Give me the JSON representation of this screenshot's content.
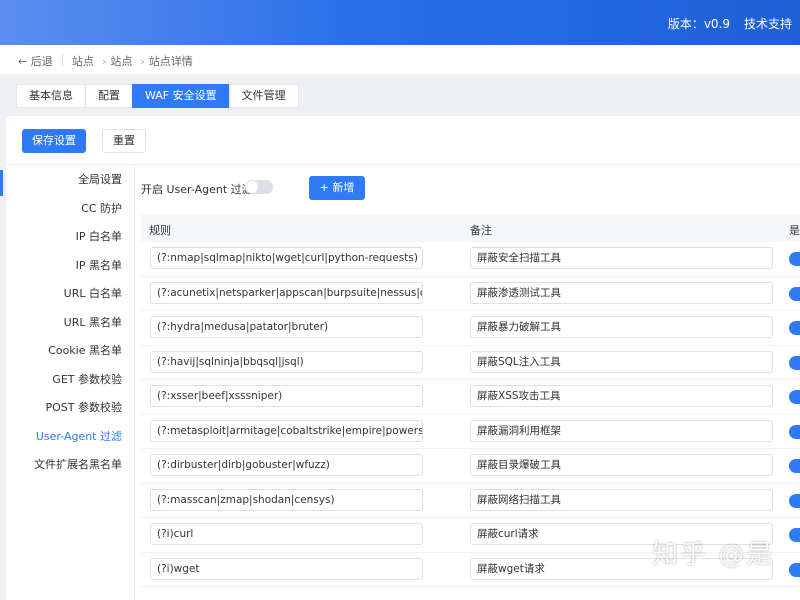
{
  "header": {
    "version": "版本：v0.9",
    "support": "技术支持"
  },
  "breadcrumb": {
    "back": "← 后退",
    "items": [
      "站点",
      "站点",
      "站点详情"
    ]
  },
  "tabs": [
    "基本信息",
    "配置",
    "WAF 安全设置",
    "文件管理"
  ],
  "actions": {
    "save": "保存设置",
    "reset": "重置"
  },
  "sidenav": [
    "全局设置",
    "CC 防护",
    "IP 白名单",
    "IP 黑名单",
    "URL 白名单",
    "URL 黑名单",
    "Cookie 黑名单",
    "GET 参数校验",
    "POST 参数校验",
    "User-Agent 过滤",
    "文件扩展名黑名单"
  ],
  "toolbar": {
    "toggle_label": "开启 User-Agent 过滤",
    "add": "+ 新增"
  },
  "table": {
    "headers": [
      "规则",
      "备注",
      "是"
    ],
    "rows": [
      {
        "rule": "(?:nmap|sqlmap|nikto|wget|curl|python-requests)",
        "note": "屏蔽安全扫描工具"
      },
      {
        "rule": "(?:acunetix|netsparker|appscan|burpsuite|nessus|openvas|zap)",
        "note": "屏蔽渗透测试工具"
      },
      {
        "rule": "(?:hydra|medusa|patator|bruter)",
        "note": "屏蔽暴力破解工具"
      },
      {
        "rule": "(?:havij|sqlninja|bbqsql|jsql)",
        "note": "屏蔽SQL注入工具"
      },
      {
        "rule": "(?:xsser|beef|xsssniper)",
        "note": "屏蔽XSS攻击工具"
      },
      {
        "rule": "(?:metasploit|armitage|cobaltstrike|empire|powersploit)",
        "note": "屏蔽漏洞利用框架"
      },
      {
        "rule": "(?:dirbuster|dirb|gobuster|wfuzz)",
        "note": "屏蔽目录爆破工具"
      },
      {
        "rule": "(?:masscan|zmap|shodan|censys)",
        "note": "屏蔽网络扫描工具"
      },
      {
        "rule": "(?i)curl",
        "note": "屏蔽curl请求"
      },
      {
        "rule": "(?i)wget",
        "note": "屏蔽wget请求"
      }
    ]
  },
  "watermark": "知乎 @是"
}
